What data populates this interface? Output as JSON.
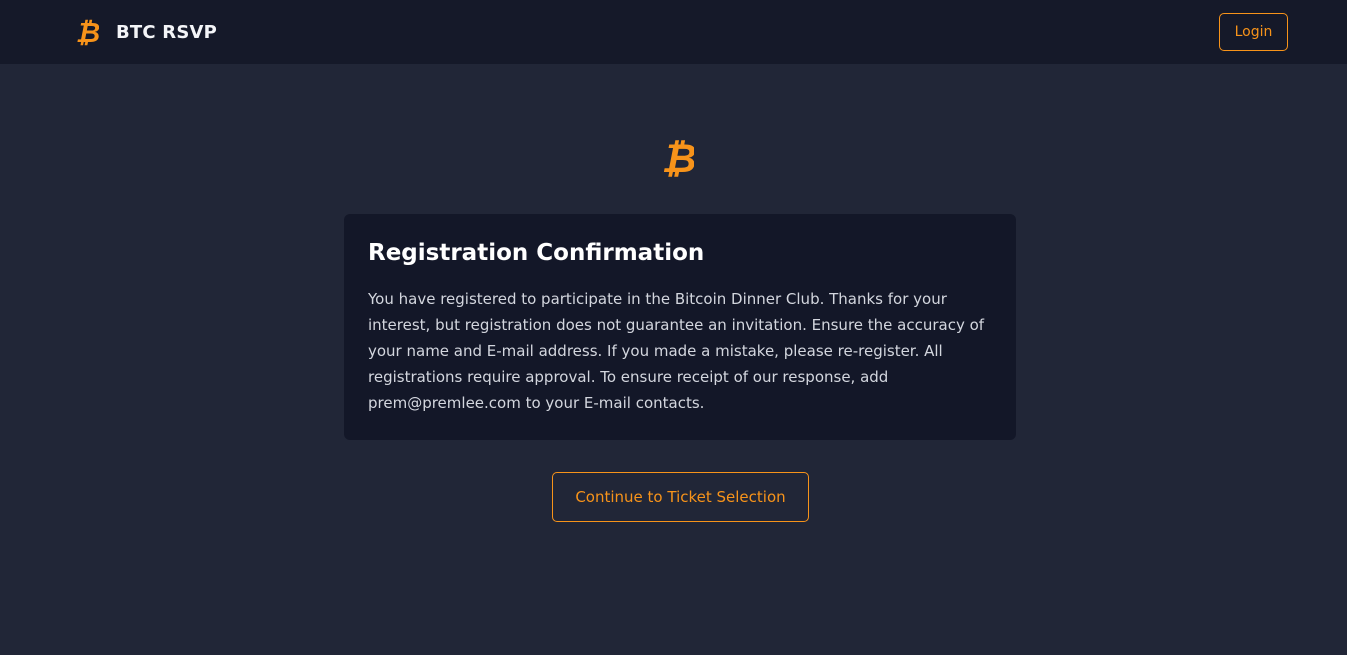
{
  "header": {
    "brand_text": "BTC RSVP",
    "brand_icon": "bitcoin-icon",
    "login_label": "Login"
  },
  "hero": {
    "icon": "bitcoin-icon"
  },
  "card": {
    "title": "Registration Confirmation",
    "body": "You have registered to participate in the Bitcoin Dinner Club. Thanks for your interest, but registration does not guarantee an invitation. Ensure the accuracy of your name and E-mail address. If you made a mistake, please re-register. All registrations require approval. To ensure receipt of our response, add prem@premlee.com to your E-mail contacts."
  },
  "actions": {
    "continue_label": "Continue to Ticket Selection"
  },
  "colors": {
    "accent": "#f7931a",
    "navbar_bg": "#151929",
    "page_bg": "#212637",
    "card_bg": "#131728"
  }
}
